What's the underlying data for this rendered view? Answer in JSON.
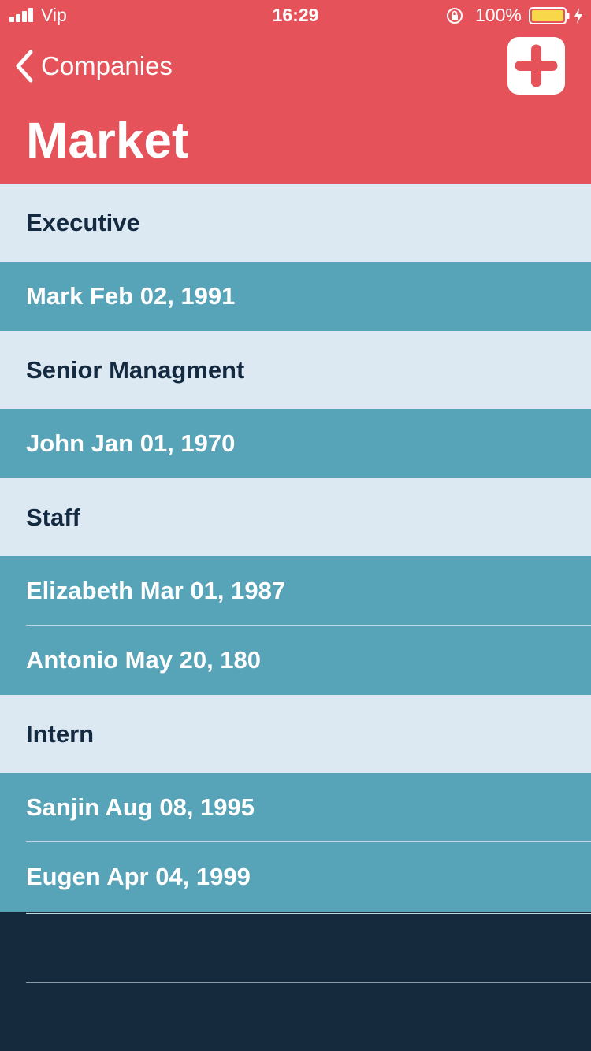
{
  "status_bar": {
    "carrier": "Vip",
    "time": "16:29",
    "battery": "100%"
  },
  "nav": {
    "back_label": "Companies",
    "title": "Market",
    "add_icon": "plus-icon"
  },
  "colors": {
    "header": "#e55259",
    "section_bg": "#dde9f2",
    "row_bg": "#57a3b7",
    "page_bg": "#162a3e"
  },
  "sections": [
    {
      "title": "Executive",
      "rows": [
        "Mark Feb 02, 1991"
      ]
    },
    {
      "title": "Senior Managment",
      "rows": [
        "John Jan 01, 1970"
      ]
    },
    {
      "title": "Staff",
      "rows": [
        "Elizabeth Mar 01, 1987",
        "Antonio May 20, 180"
      ]
    },
    {
      "title": "Intern",
      "rows": [
        "Sanjin Aug 08, 1995",
        "Eugen Apr 04, 1999"
      ]
    }
  ]
}
